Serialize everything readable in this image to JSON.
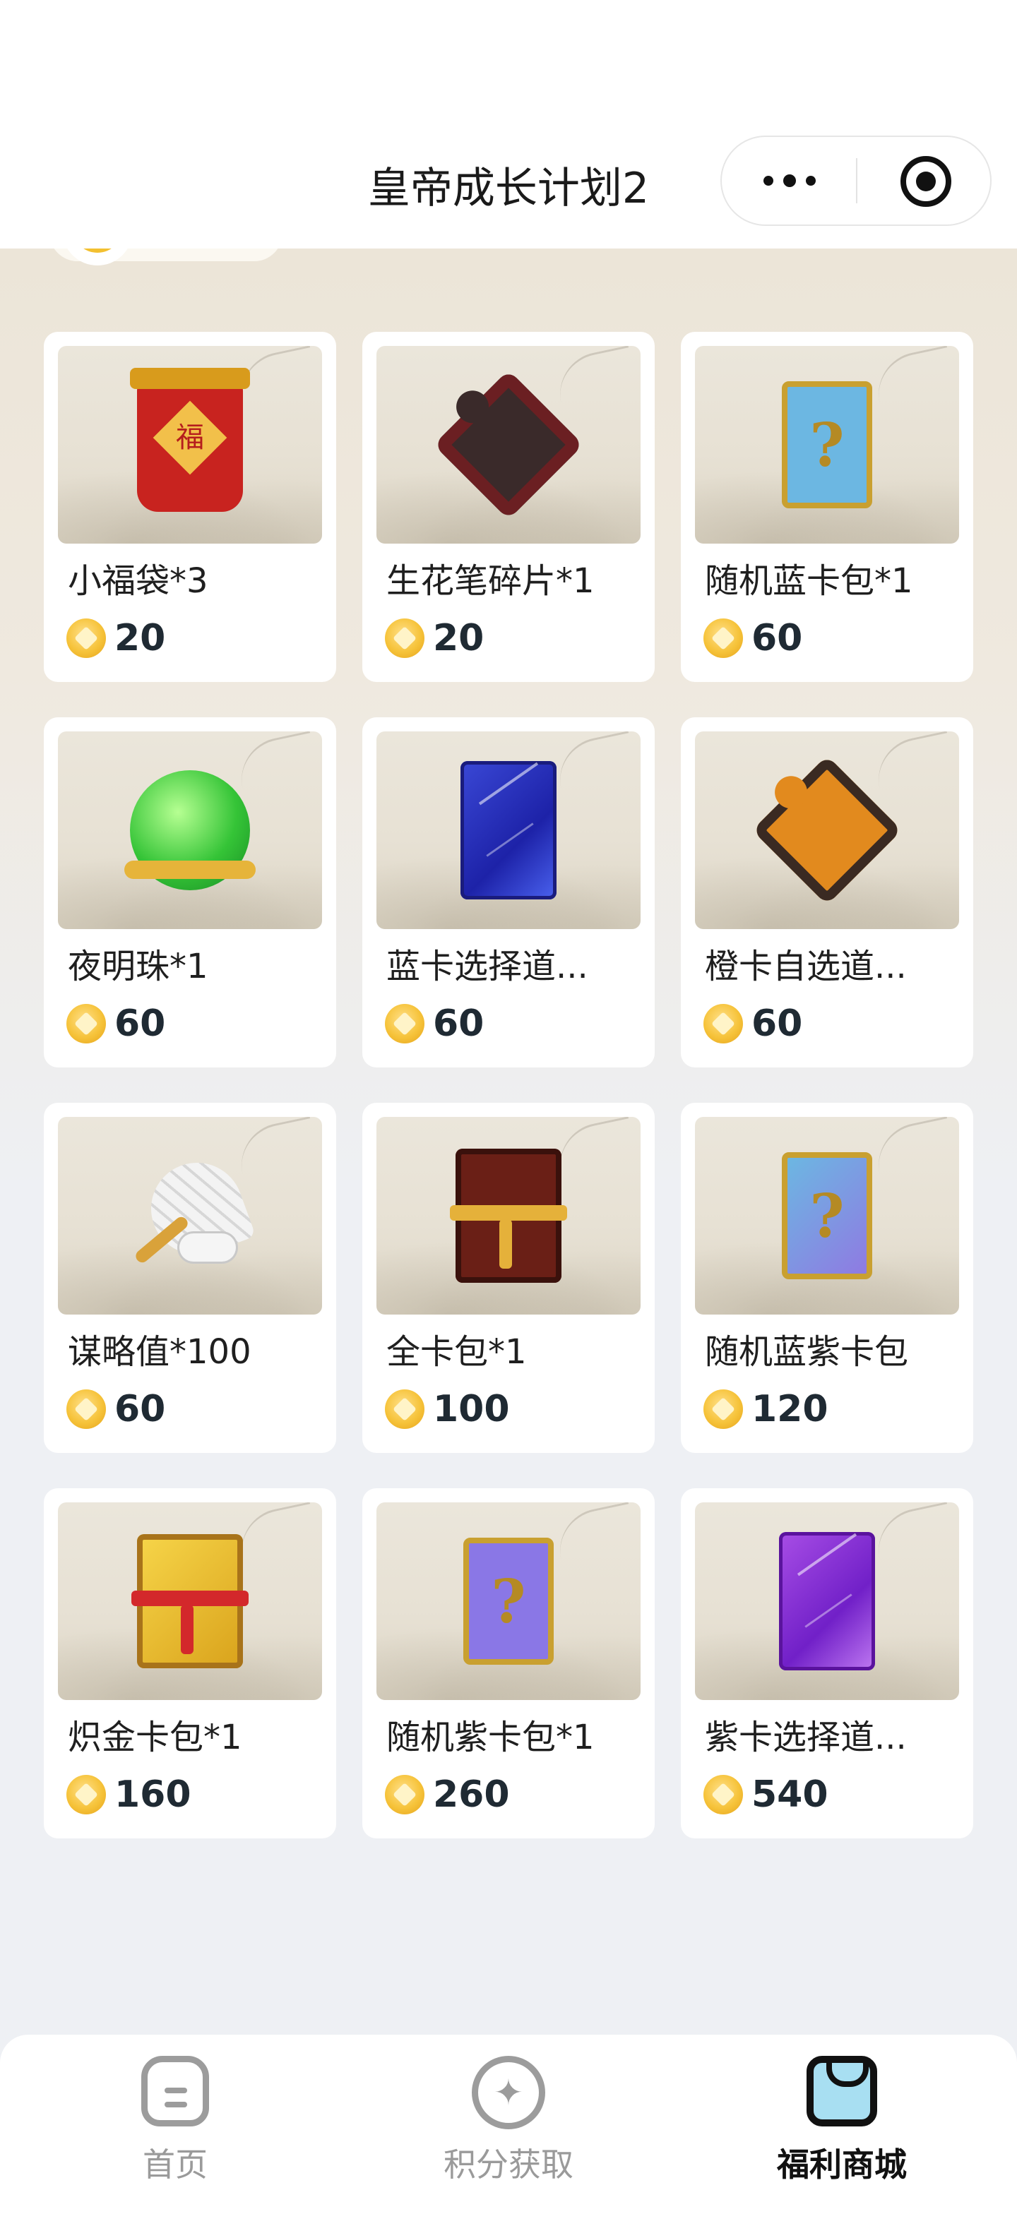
{
  "header": {
    "title": "皇帝成长计划2"
  },
  "products": [
    {
      "name": "小福袋*3",
      "price": "20",
      "icon": "lucky-bag-icon"
    },
    {
      "name": "生花笔碎片*1",
      "price": "20",
      "icon": "puzzle-fragment-icon"
    },
    {
      "name": "随机蓝卡包*1",
      "price": "60",
      "icon": "blue-card-pack-icon"
    },
    {
      "name": "夜明珠*1",
      "price": "60",
      "icon": "night-pearl-icon"
    },
    {
      "name": "蓝卡选择道...",
      "price": "60",
      "icon": "blue-card-selector-icon"
    },
    {
      "name": "橙卡自选道...",
      "price": "60",
      "icon": "orange-card-selector-icon"
    },
    {
      "name": "谋略值*100",
      "price": "60",
      "icon": "feather-fan-icon"
    },
    {
      "name": "全卡包*1",
      "price": "100",
      "icon": "full-card-pack-icon"
    },
    {
      "name": "随机蓝紫卡包",
      "price": "120",
      "icon": "blue-purple-card-pack-icon"
    },
    {
      "name": "炽金卡包*1",
      "price": "160",
      "icon": "golden-card-pack-icon"
    },
    {
      "name": "随机紫卡包*1",
      "price": "260",
      "icon": "purple-card-pack-icon"
    },
    {
      "name": "紫卡选择道...",
      "price": "540",
      "icon": "purple-card-selector-icon"
    }
  ],
  "tabbar": {
    "home": "首页",
    "points": "积分获取",
    "shop": "福利商城"
  },
  "colors": {
    "price_text": "#1f2a33",
    "coin": "#f6c33a",
    "active_tab": "#111111",
    "inactive_tab": "#9a9a9a"
  }
}
